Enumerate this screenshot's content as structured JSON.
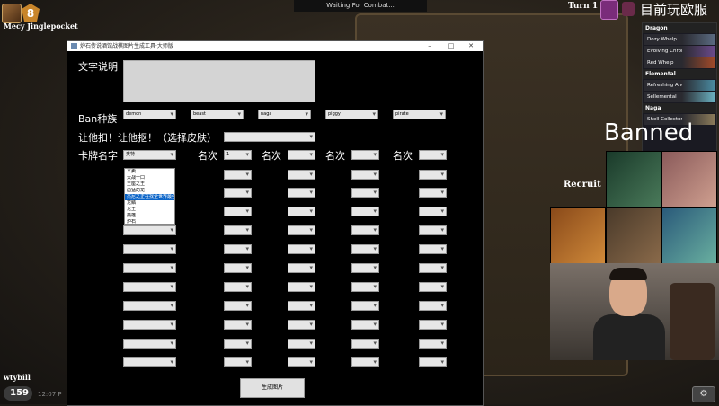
{
  "game": {
    "tier": "8",
    "player_name": "Mecy Jinglepocket",
    "status": "Waiting For Combat...",
    "turn_label": "Turn 1",
    "overlay_title": "目前玩欧服",
    "banned_label": "Banned",
    "recruit_label": "Recruit",
    "bottom_player": "wtybill",
    "coins": "159",
    "clock": "12:07 P",
    "tribes": [
      {
        "name": "Dragon",
        "cards": [
          "Dozy Whelp",
          "Evolving Chromawing",
          "Red Whelp"
        ]
      },
      {
        "name": "Elemental",
        "cards": [
          "Refreshing Anomaly",
          "Sellemental"
        ]
      },
      {
        "name": "Naga",
        "cards": [
          "Shell Collector"
        ]
      }
    ]
  },
  "app": {
    "title": "炉石传说酒馆战棋图片生成工具·大师版",
    "controls": {
      "minimize": "–",
      "maximize": "□",
      "close": "✕"
    },
    "desc_label": "文字说明",
    "ban_label": "Ban种族",
    "ban_options": [
      "demon",
      "beast",
      "naga",
      "piggy",
      "pirate"
    ],
    "skin_label": "让他扣！让他抠！（选择皮肤）",
    "card_label": "卡牌名字",
    "card_first": "奥特",
    "rank_label": "名次",
    "rank_first": "1",
    "dropdown_items": [
      "义卖",
      "大战一口",
      "王座之王",
      "凶猛的龙",
      "杰尼之正在找全世界最强",
      "龙鳞",
      "龙王",
      "英雄",
      "炉石"
    ],
    "dropdown_selected": 4,
    "generate_button": "生成图片"
  }
}
